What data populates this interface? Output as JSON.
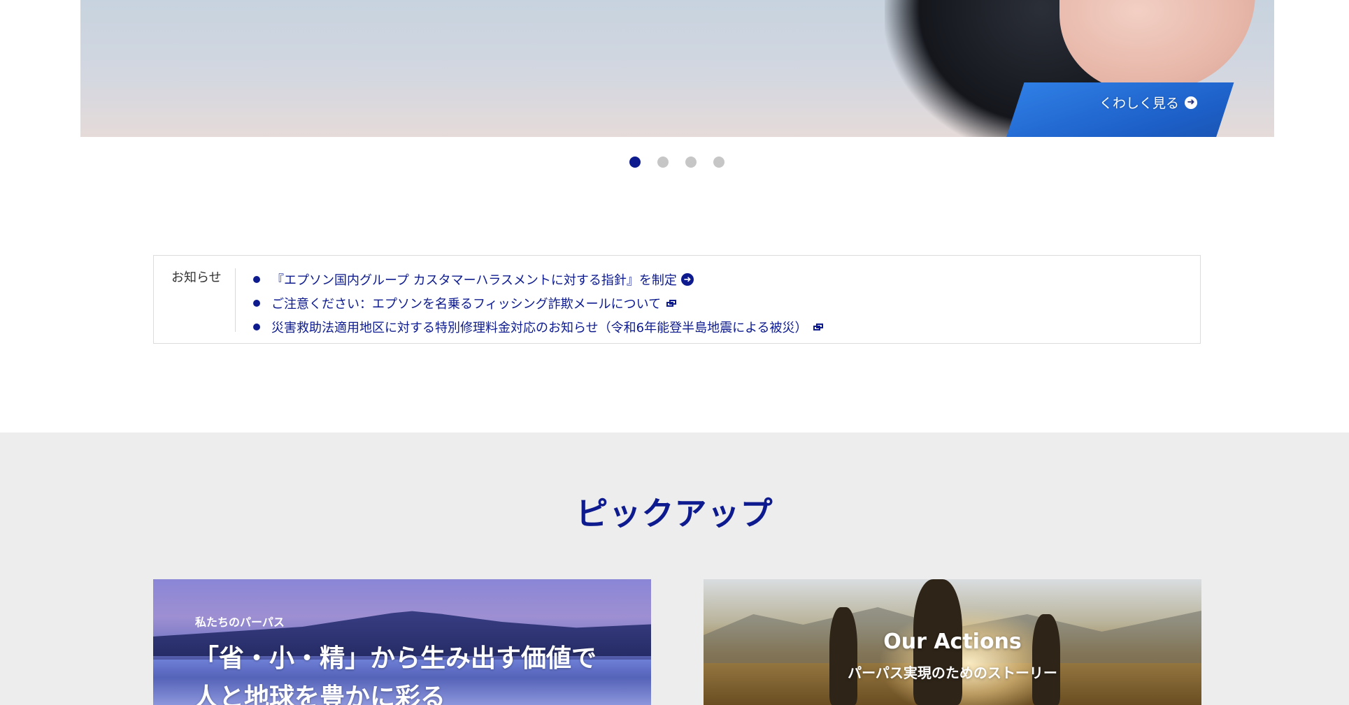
{
  "hero": {
    "link_label": "くわしく見る"
  },
  "carousel": {
    "total": 4,
    "active_index": 1
  },
  "news": {
    "label": "お知らせ",
    "items": [
      {
        "text": "『エプソン国内グループ カスタマーハラスメントに対する指針』を制定",
        "icon": "arrow-circle-icon"
      },
      {
        "text": "ご注意ください：エプソンを名乗るフィッシング詐欺メールについて",
        "icon": "external-link-icon"
      },
      {
        "text": "災害救助法適用地区に対する特別修理料金対応のお知らせ（令和6年能登半島地震による被災）",
        "icon": "external-link-icon"
      }
    ]
  },
  "pickup": {
    "title": "ピックアップ",
    "cards": [
      {
        "subtitle": "私たちのパーパス",
        "title_line1": "「省・小・精」から生み出す価値で",
        "title_line2": "人と地球を豊かに彩る"
      },
      {
        "title": "Our Actions",
        "subtitle": "パーパス実現のためのストーリー"
      }
    ]
  },
  "colors": {
    "brand_navy": "#0d1b8e",
    "inactive_dot": "#c6c6c6",
    "section_bg": "#ededed"
  }
}
